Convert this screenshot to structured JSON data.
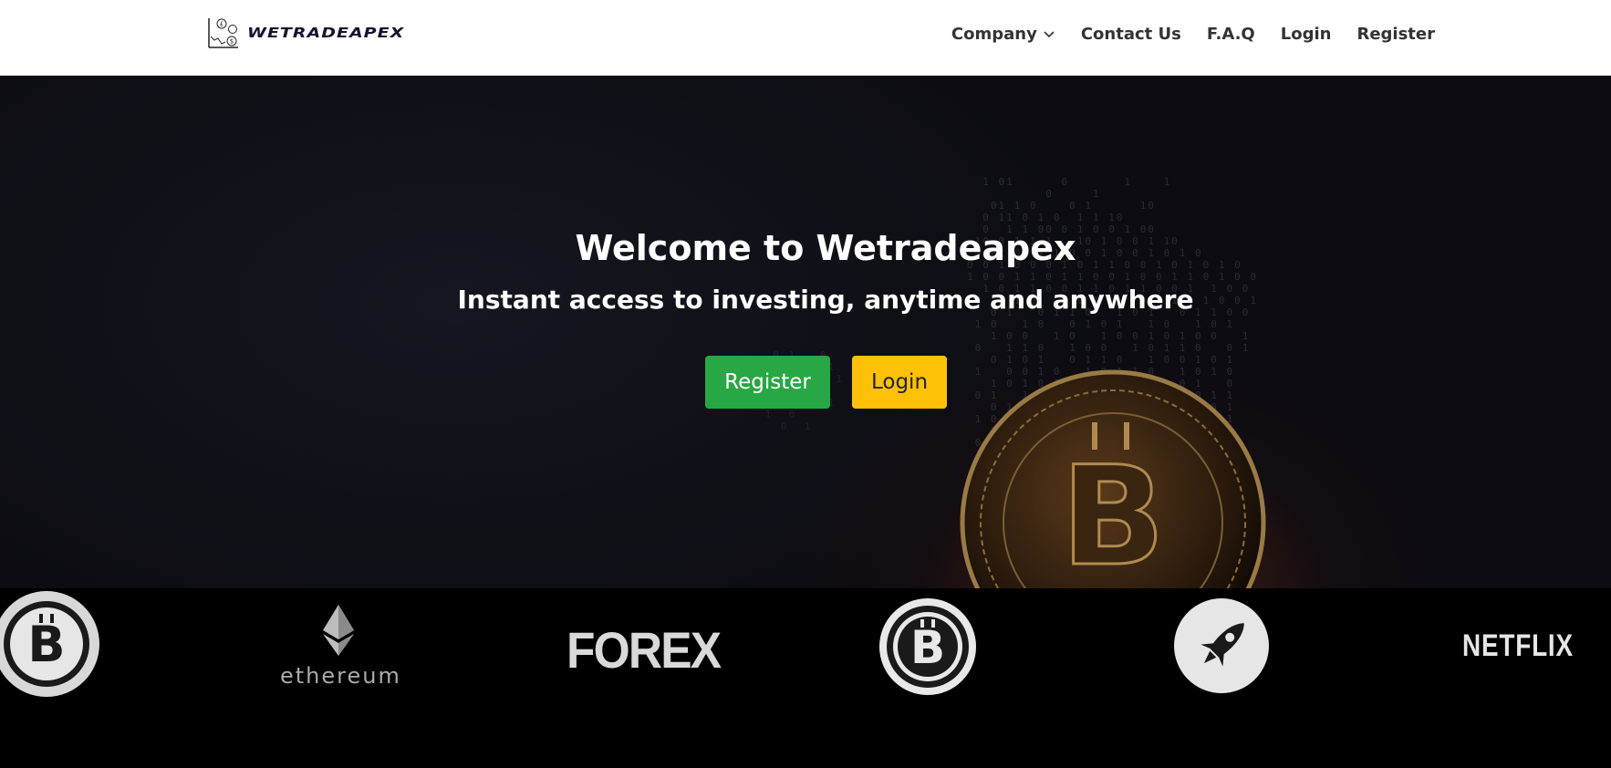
{
  "brand": {
    "name": "WETRADEAPEX",
    "icon": "currency-chart-icon"
  },
  "nav": {
    "company": "Company",
    "contact": "Contact Us",
    "faq": "F.A.Q",
    "login": "Login",
    "register": "Register"
  },
  "hero": {
    "title": "Welcome to Wetradeapex",
    "subtitle": "Instant access to investing, anytime and anywhere",
    "register_button": "Register",
    "login_button": "Login",
    "background_icon": "bitcoin-coin-icon"
  },
  "logos": {
    "items": [
      "bitcoin-cash-icon",
      "ethereum",
      "FOREX",
      "bitcoin-icon",
      "rocket-icon",
      "NETFLIX"
    ],
    "ethereum_text": "ethereum",
    "forex_text": "FOREX",
    "netflix_text": "NETFLIX"
  },
  "colors": {
    "register_green": "#28a745",
    "login_yellow": "#ffc107",
    "navbar_bg": "#ffffff",
    "hero_bg": "#0f0f16"
  }
}
